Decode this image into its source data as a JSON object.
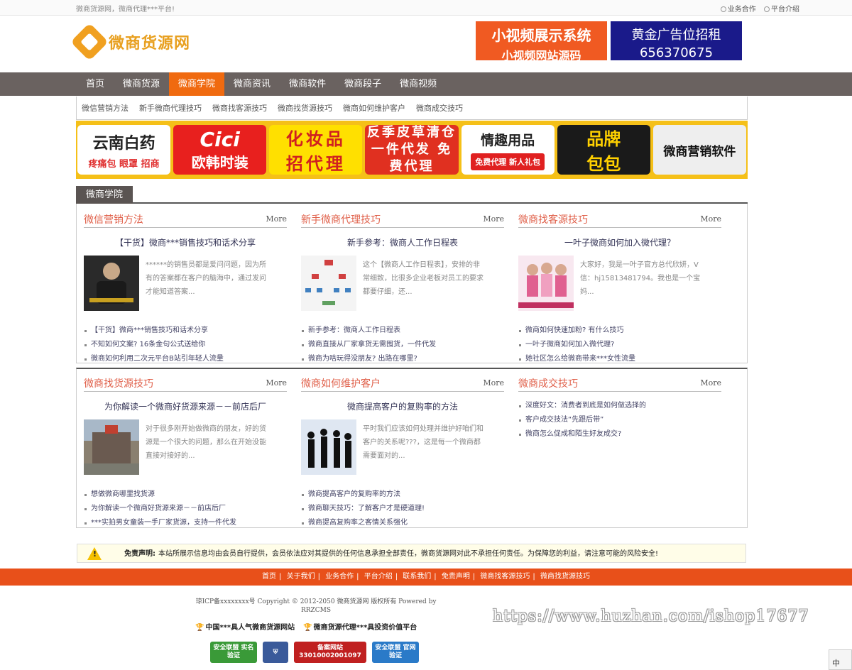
{
  "topbar": {
    "slogan": "微商货源网，微商代理***平台!",
    "links": [
      "业务合作",
      "平台介绍"
    ]
  },
  "logo": {
    "text": "微商货源网"
  },
  "ads": [
    {
      "line1": "小视频展示系统",
      "line2": "小视频网站源码"
    },
    {
      "line1": "黄金广告位招租",
      "line2": "656370675"
    }
  ],
  "nav": {
    "items": [
      "首页",
      "微商货源",
      "微商学院",
      "微商资讯",
      "微商软件",
      "微商段子",
      "微商视频"
    ],
    "active": "微商学院"
  },
  "subnav": [
    "微信营销方法",
    "新手微商代理技巧",
    "微商找客源技巧",
    "微商找货源技巧",
    "微商如何维护客户",
    "微商成交技巧"
  ],
  "banners": [
    {
      "title": "云南白药",
      "sub": "疼痛包 眼罩 招商"
    },
    {
      "title": "Cici",
      "sub": "欧韩时装"
    },
    {
      "title": "化妆品",
      "sub": "招代理"
    },
    {
      "title": "反季皮草清仓",
      "sub": "一件代发 免费代理"
    },
    {
      "title": "情趣用品",
      "sub": "免费代理 新人礼包"
    },
    {
      "title": "品牌",
      "sub": "包包"
    },
    {
      "title": "微商营销软件",
      "sub": ""
    }
  ],
  "section": {
    "title": "微商学院",
    "more_label": "More"
  },
  "columns": [
    {
      "title": "微信营销方法",
      "featured": "【干货】微商***销售技巧和话术分享",
      "desc": "******的销售员都是爱问问题，因为所有的答案都在客户的脑海中，通过发问才能知道答案...",
      "items": [
        "【干货】微商***销售技巧和话术分享",
        "不知如何文案? 16条金句公式送给你",
        "微商如何利用二次元平台B站引年轻人流量"
      ]
    },
    {
      "title": "新手微商代理技巧",
      "featured": "新手参考：微商人工作日程表",
      "desc": "这个【微商人工作日程表】，安排的非常细致，比很多企业老板对员工的要求都要仔细，还...",
      "items": [
        "新手参考：微商人工作日程表",
        "微商直接从厂家拿货无需囤货，一件代发",
        "微商为啥玩得没朋友? 出路在哪里?"
      ]
    },
    {
      "title": "微商找客源技巧",
      "featured": "一叶子微商如何加入微代理？",
      "desc": "大家好，我是一叶子官方总代欣妍，V信：hj15813481794。我也是一个宝妈...",
      "items": [
        "微商如何快速加粉? 有什么技巧",
        "一叶子微商如何加入微代理?",
        "她社区怎么给微商带来***女性流量"
      ]
    },
    {
      "title": "微商找货源技巧",
      "featured": "为你解读一个微商好货源来源－－前店后厂",
      "desc": "对于很多刚开始做微商的朋友，好的货源是一个很大的问题，那么在开始没能直接对接好的...",
      "items": [
        "想做微商哪里找货源",
        "为你解读一个微商好货源来源－－前店后厂",
        "***实拍男女童装一手厂家货源，支持一件代发"
      ]
    },
    {
      "title": "微商如何维护客户",
      "featured": "微商提高客户的复购率的方法",
      "desc": "平时我们应该如何处理并维护好咱们和客户的关系呢???，这是每一个微商都需要面对的...",
      "items": [
        "微商提高客户的复购率的方法",
        "微商聊天技巧：了解客户才是硬道理!",
        "微商提高复购率之客情关系强化"
      ]
    },
    {
      "title": "微商成交技巧",
      "featured": "",
      "desc": "",
      "items": [
        "深度好文：消费者到底是如何做选择的",
        "客户成交技法“先跟后带”",
        "微商怎么促成和陌生好友成交?"
      ]
    }
  ],
  "notice": {
    "label": "免责声明:",
    "text": "本站所展示信息均由会员自行提供，会员依法应对其提供的任何信息承担全部责任，微商货源网对此不承担任何责任。为保障您的利益，请注意可能的风险安全!"
  },
  "footer": {
    "nav": [
      "首页",
      "关于我们",
      "业务合作",
      "平台介绍",
      "联系我们",
      "免责声明",
      "微商找客源技巧",
      "微商找货源技巧"
    ],
    "copyright": "琼ICP备xxxxxxxx号  Copyright © 2012-2050 微商货源网 版权所有 Powered by RRZCMS",
    "honors": [
      "中国***具人气微商货源网站",
      "微商货源代理***具投资价值平台"
    ],
    "badges": [
      "安全联盟 实名验证",
      "",
      "备案网站 33010002001097",
      "安全联盟 官网验证"
    ]
  },
  "watermark": "https://www.huzhan.com/ishop17677",
  "ime": "中"
}
